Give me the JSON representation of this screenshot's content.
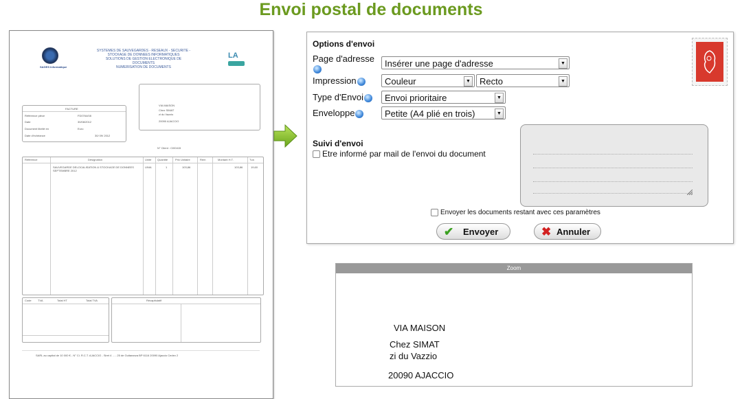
{
  "title": "Envoi postal de documents",
  "doc": {
    "company_lines": [
      "SYSTEMES DE SAUVEGARDES - RESEAUX - SECURITE -",
      "STOCKAGE DE DONNEES INFORMATIQUES",
      "SOLUTIONS DE GESTION ELECTRONIQUE DE",
      "DOCUMENTS",
      "NUMERISATION DE DOCUMENTS"
    ],
    "logo_text": "SAGES Informatique",
    "logo2_text": "LA numérique",
    "recipient_lines": [
      "VIA MAISON",
      "Chez SIMAT",
      "zi du Vazzio",
      "20090 AJACCIO"
    ],
    "facture_title": "FACTURE",
    "facture_rows": [
      {
        "label": "Référence pièce",
        "value": "FD0764/08"
      },
      {
        "label": "Date",
        "value": "30/08/2012"
      },
      {
        "label": "Document libellé en",
        "value": "Euro"
      },
      {
        "label": "Date d'échéance",
        "value": "30/ 09/ 2012"
      }
    ],
    "client_no": "N° Client : CI00415",
    "table_headers": [
      "Référence",
      "Désignation",
      "Unité",
      "Quantité",
      "Prix Unitaire",
      "Rem",
      "Montant H.T.",
      "Tva"
    ],
    "table_row": {
      "designation": "SAUVEGARDE DELOCALISATION & STOCKAGE DE DONNEES SEPTEMBRE 2012",
      "unit": "UNIA",
      "qty": "1",
      "pu": "103,86",
      "montant": "103,86",
      "tva": "19,60"
    },
    "tva_headers": [
      "Code",
      "TVA",
      "Total HT",
      "Total TVA"
    ],
    "recap_title": "Récapitulatif",
    "footer_text": "SARL au capital de 10 000 € - N° Ci. R.C.T. AJACCIO - Siret 4 ... - 25 de Guitaranza BP 6116 20090 Ajaccio Cedex 2"
  },
  "options": {
    "section_title": "Options d'envoi",
    "page_adresse_label": "Page d'adresse",
    "page_adresse_value": "Insérer une page d'adresse",
    "impression_label": "Impression",
    "impression_value": "Couleur",
    "recto_value": "Recto",
    "type_envoi_label": "Type d'Envoi",
    "type_envoi_value": "Envoi prioritaire",
    "enveloppe_label": "Enveloppe",
    "enveloppe_value": "Petite (A4 plié en trois)",
    "suivi_title": "Suivi d'envoi",
    "suivi_checkbox_label": "Etre informé par mail de l'envoi du document",
    "restants_checkbox_label": "Envoyer les documents restant avec ces paramètres",
    "send_label": "Envoyer",
    "cancel_label": "Annuler"
  },
  "zoom": {
    "header": "Zoom",
    "lines": [
      "VIA MAISON",
      "Chez SIMAT",
      "zi du Vazzio",
      "20090 AJACCIO"
    ]
  }
}
